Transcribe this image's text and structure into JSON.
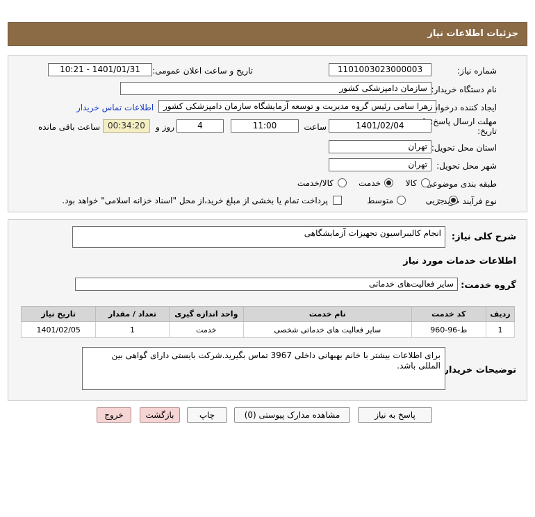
{
  "header": {
    "title": "جزئیات اطلاعات نیاز"
  },
  "fields": {
    "need_number_label": "شماره نیاز:",
    "need_number": "1101003023000003",
    "announce_label": "تاریخ و ساعت اعلان عمومی:",
    "announce_value": "1401/01/31 - 10:21",
    "buyer_org_label": "نام دستگاه خریدار:",
    "buyer_org": "سازمان دامپزشکی کشور",
    "requester_label": "ایجاد کننده درخواست:",
    "requester": "زهرا سامی  رئیس گروه مدیریت و توسعه آزمایشگاه سازمان دامپزشکی کشور",
    "contact_link": "اطلاعات تماس خریدار",
    "deadline_label_1": "مهلت ارسال پاسخ: تا",
    "deadline_label_2": "تاریخ:",
    "deadline_date": "1401/02/04",
    "time_label": "ساعت",
    "deadline_time": "11:00",
    "days_value": "4",
    "days_label": "روز و",
    "remaining_time": "00:34:20",
    "remaining_label": "ساعت باقی مانده",
    "province_label": "استان محل تحویل:",
    "province": "تهران",
    "city_label": "شهر محل تحویل:",
    "city": "تهران",
    "category_label": "طبقه بندی موضوعی:",
    "category_options": [
      "کالا",
      "خدمت",
      "کالا/خدمت"
    ],
    "process_label": "نوع فرآیند خرید :",
    "process_options": [
      "جزیی",
      "متوسط"
    ],
    "payment_note": "پرداخت تمام یا بخشی از مبلغ خرید،از محل \"اسناد خزانه اسلامی\" خواهد بود."
  },
  "summary": {
    "general_desc_label": "شرح کلی نیاز:",
    "general_desc": "انجام کالیبراسیون تجهیزات آزمایشگاهی",
    "services_title": "اطلاعات خدمات مورد نیاز",
    "service_group_label": "گروه خدمت:",
    "service_group": "سایر فعالیت‌های خدماتی"
  },
  "table": {
    "headers": [
      "ردیف",
      "کد خدمت",
      "نام خدمت",
      "واحد اندازه گیری",
      "تعداد / مقدار",
      "تاریخ نیاز"
    ],
    "rows": [
      [
        "1",
        "ط-96-960",
        "سایر فعالیت های خدماتی شخصی",
        "خدمت",
        "1",
        "1401/02/05"
      ]
    ]
  },
  "buyer_notes": {
    "label": "توضیحات خریدار:",
    "text": "برای اطلاعات بیشتر با خانم بهبهانی داخلی 3967 تماس بگیرید.شرکت بایستی دارای گواهی بین المللی باشد."
  },
  "buttons": {
    "reply": "پاسخ به نیاز",
    "attachments": "مشاهده مدارک پیوستی (0)",
    "print": "چاپ",
    "back": "بازگشت",
    "exit": "خروج"
  },
  "colors": {
    "header_bg": "#8b6a46",
    "link": "#1a3cc6",
    "timer_bg": "#f4eec2",
    "exit_bg": "#f6d4d4"
  }
}
